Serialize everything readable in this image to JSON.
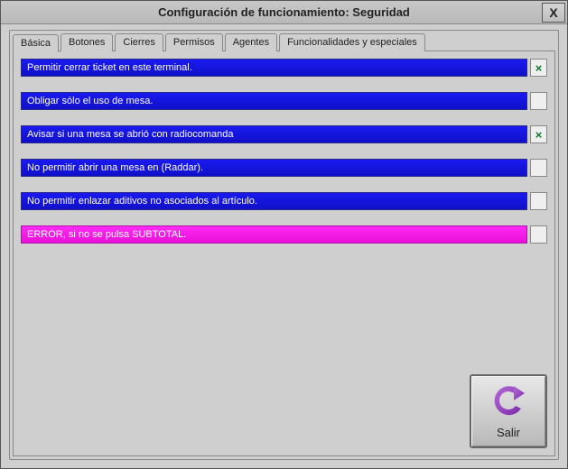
{
  "titlebar": {
    "title": "Configuración de funcionamiento: Seguridad",
    "close": "X"
  },
  "tabs": [
    {
      "label": "Básica",
      "active": true
    },
    {
      "label": "Botones",
      "active": false
    },
    {
      "label": "Cierres",
      "active": false
    },
    {
      "label": "Permisos",
      "active": false
    },
    {
      "label": "Agentes",
      "active": false
    },
    {
      "label": "Funcionalidades y especiales",
      "active": false
    }
  ],
  "options": [
    {
      "label": "Permitir cerrar ticket en este terminal.",
      "checked": true,
      "color": "blue"
    },
    {
      "label": "Obligar sólo el uso de mesa.",
      "checked": false,
      "color": "blue"
    },
    {
      "label": "Avisar si una mesa se abrió con radiocomanda",
      "checked": true,
      "color": "blue"
    },
    {
      "label": "No permitir abrir una mesa en (Raddar).",
      "checked": false,
      "color": "blue"
    },
    {
      "label": "No permitir enlazar aditivos no asociados al artículo.",
      "checked": false,
      "color": "blue"
    },
    {
      "label": "ERROR, si no se pulsa SUBTOTAL.",
      "checked": false,
      "color": "magenta"
    }
  ],
  "exit": {
    "label": "Salir"
  },
  "glyphs": {
    "check": "×"
  }
}
